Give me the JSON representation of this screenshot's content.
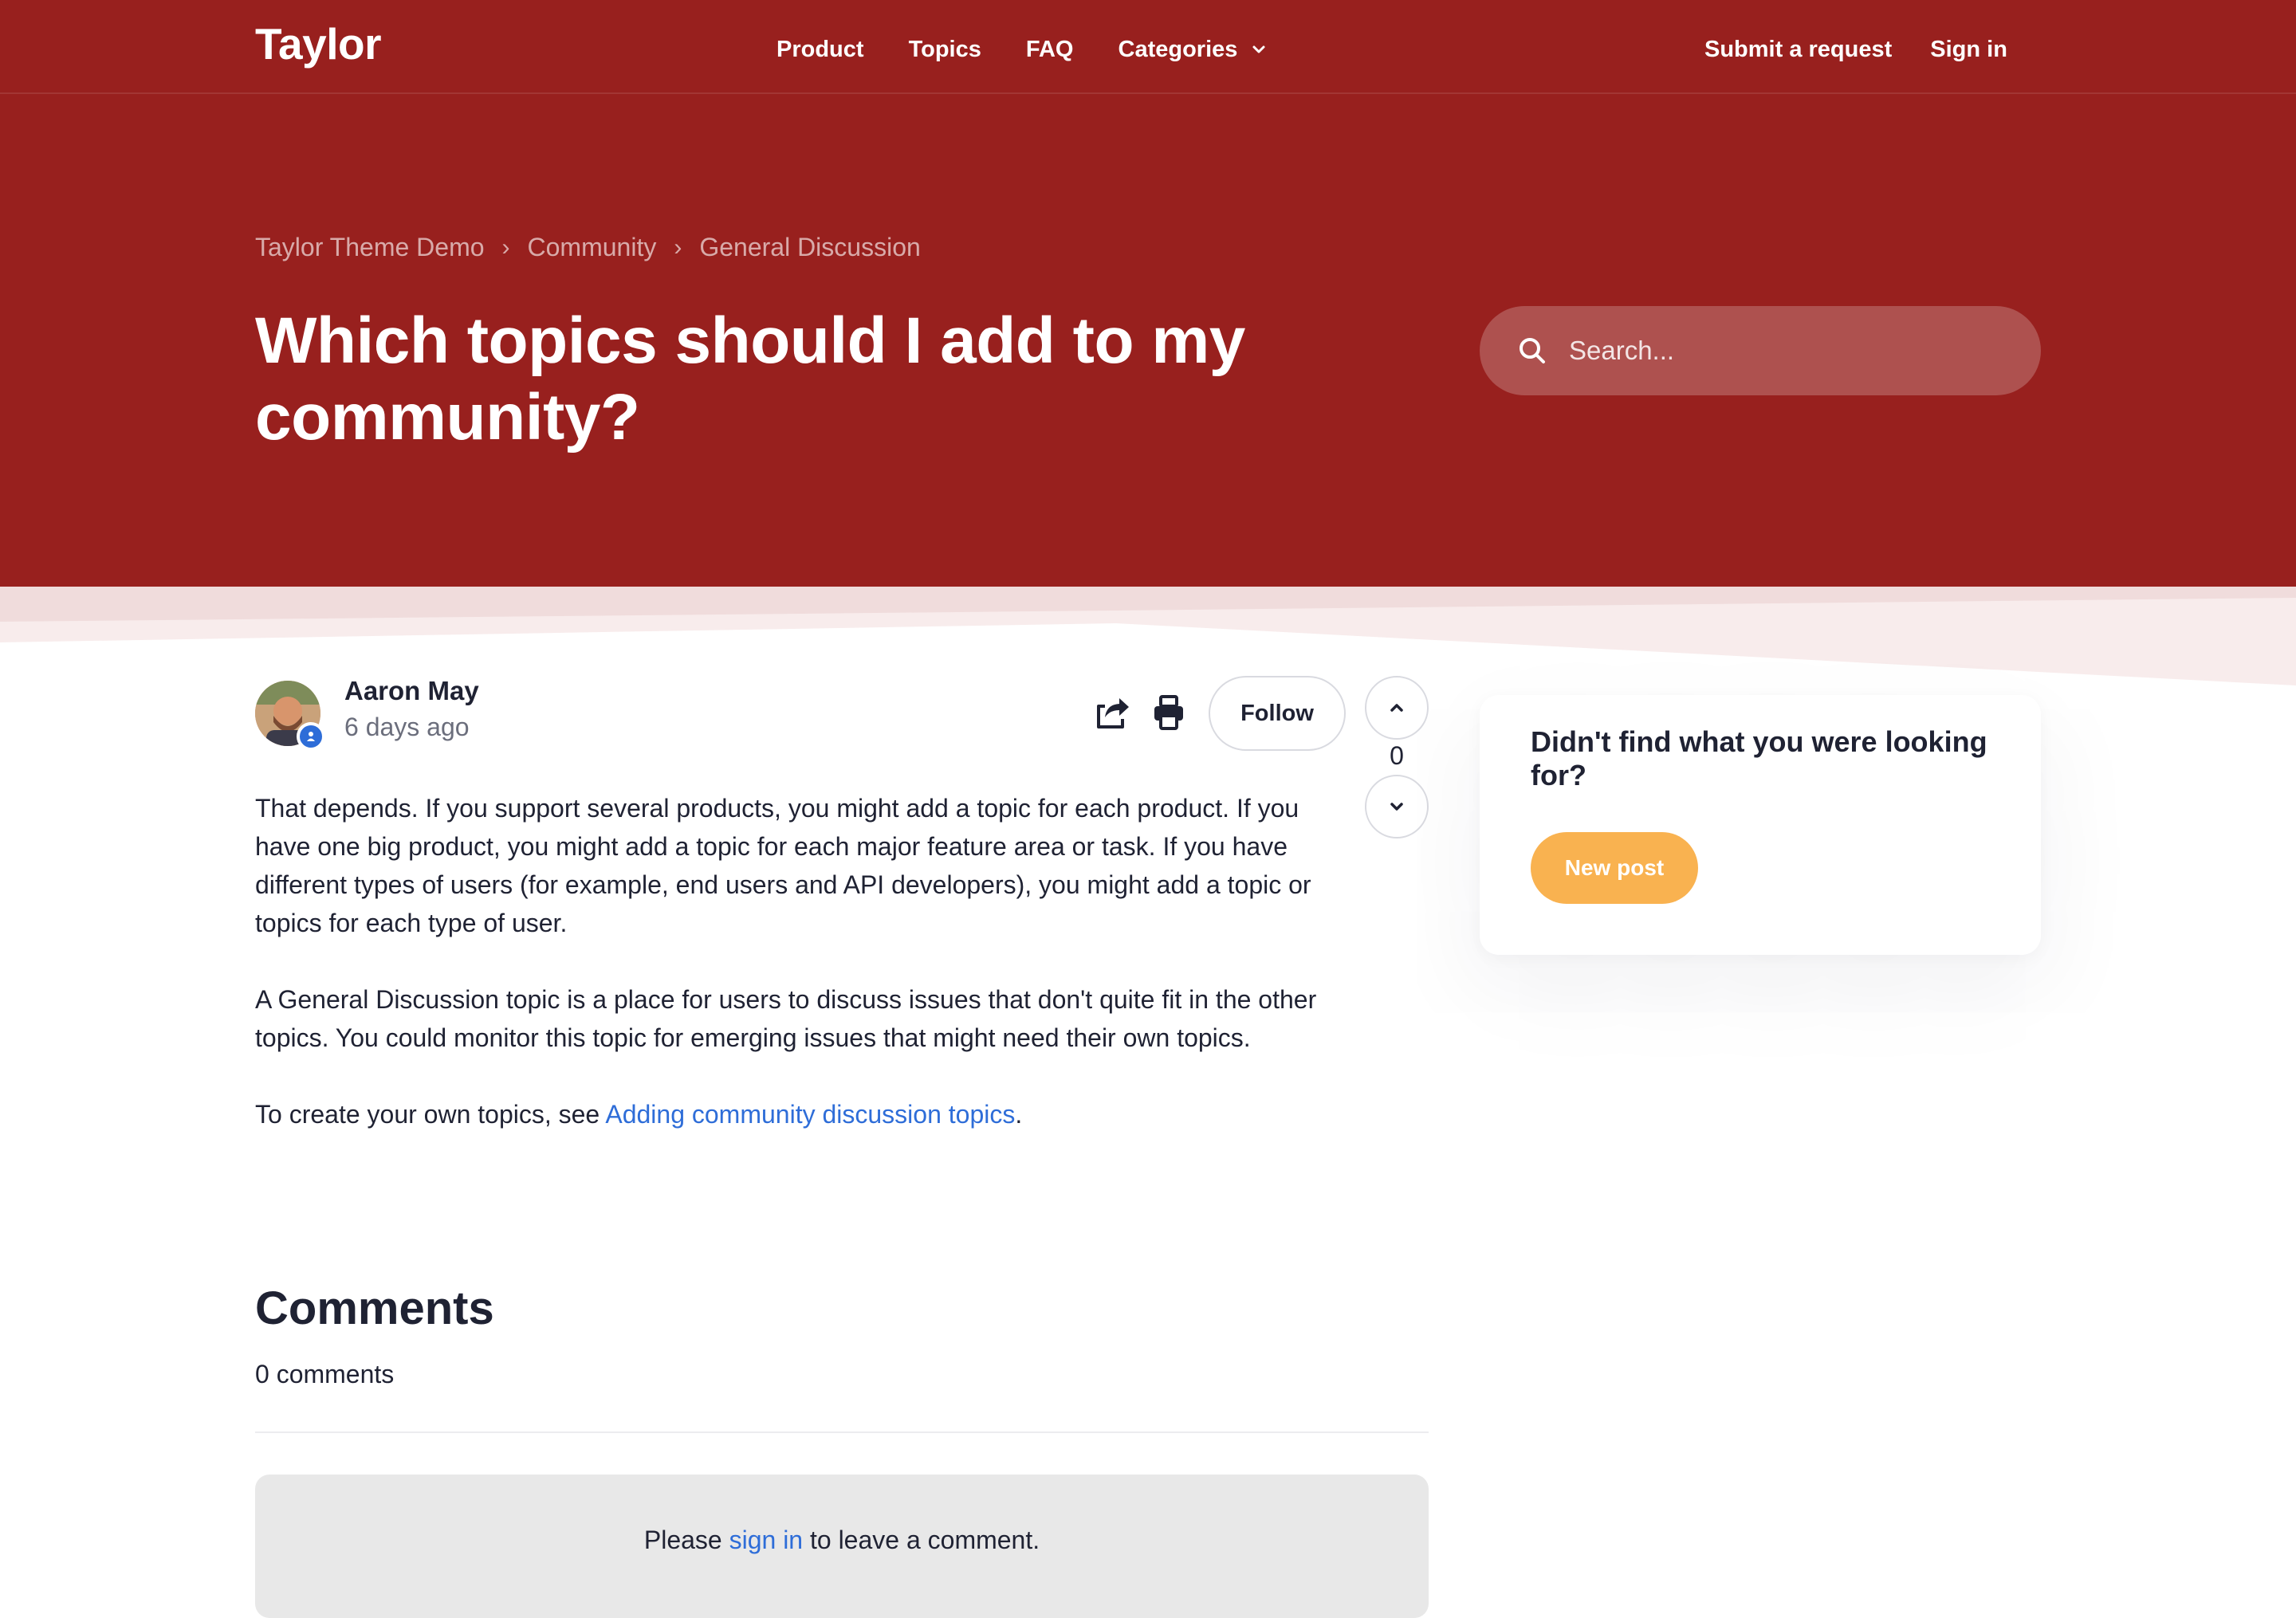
{
  "header": {
    "logo": "Taylor",
    "nav": [
      "Product",
      "Topics",
      "FAQ",
      "Categories"
    ],
    "submit_request": "Submit a request",
    "sign_in": "Sign in"
  },
  "breadcrumb": [
    "Taylor Theme Demo",
    "Community",
    "General Discussion"
  ],
  "page_title": "Which topics should I add to my community?",
  "search": {
    "placeholder": "Search..."
  },
  "post": {
    "author": "Aaron May",
    "time": "6 days ago",
    "follow_label": "Follow",
    "vote_count": "0",
    "paragraphs": [
      "That depends. If you support several products, you might add a topic for each product. If you have one big product, you might add a topic for each major feature area or task. If you have different types of users (for example, end users and API developers), you might add a topic or topics for each type of user.",
      "A General Discussion topic is a place for users to discuss issues that don't quite fit in the other topics. You could monitor this topic for emerging issues that might need their own topics."
    ],
    "closing_prefix": "To create your own topics, see ",
    "closing_link": "Adding community discussion topics",
    "closing_suffix": "."
  },
  "comments": {
    "title": "Comments",
    "count": "0 comments",
    "signin_prefix": "Please ",
    "signin_link": "sign in",
    "signin_suffix": " to leave a comment."
  },
  "sidebar": {
    "heading": "Didn't find what you were looking for?",
    "button": "New post"
  },
  "colors": {
    "brand": "#98201e",
    "accent": "#f9b250",
    "link": "#2e6dd8"
  }
}
